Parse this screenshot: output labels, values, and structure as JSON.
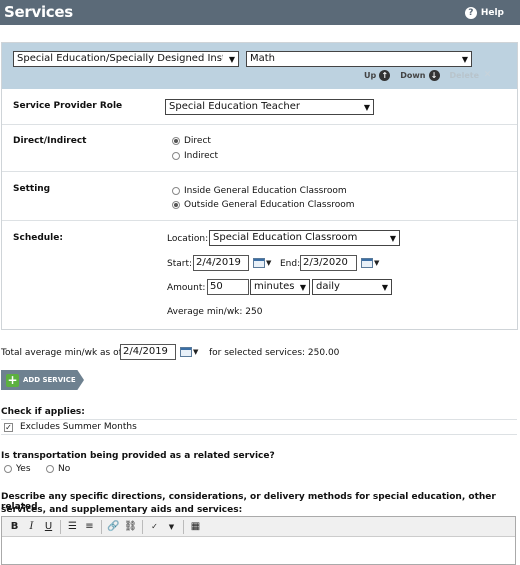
{
  "header": {
    "title": "Services",
    "help_label": "Help"
  },
  "service": {
    "category_value": "Special Education/Specially Designed Instru",
    "subject_value": "Math",
    "controls": {
      "up": "Up",
      "down": "Down",
      "delete": "Delete"
    },
    "provider_role": {
      "label": "Service Provider Role",
      "value": "Special Education Teacher"
    },
    "direct_indirect": {
      "label": "Direct/Indirect",
      "options": [
        "Direct",
        "Indirect"
      ],
      "selected": "Direct"
    },
    "setting": {
      "label": "Setting",
      "options": [
        "Inside General Education Classroom",
        "Outside General Education Classroom"
      ],
      "selected": "Outside General Education Classroom"
    },
    "schedule": {
      "label": "Schedule:",
      "location_label": "Location:",
      "location_value": "Special Education Classroom",
      "start_label": "Start:",
      "start_value": "2/4/2019",
      "end_label": "End:",
      "end_value": "2/3/2020",
      "amount_label": "Amount:",
      "amount_value": "50",
      "unit_value": "minutes",
      "frequency_value": "daily",
      "average_text": "Average min/wk: 250"
    }
  },
  "total": {
    "prefix": "Total average min/wk as of",
    "date_value": "2/4/2019",
    "suffix": "for selected services: 250.00"
  },
  "add_service_label": "ADD SERVICE",
  "applies": {
    "heading": "Check if applies:",
    "excludes_summer": "Excludes Summer Months",
    "excludes_summer_checked": true
  },
  "transportation": {
    "question": "Is transportation being provided as a related service?",
    "yes": "Yes",
    "no": "No"
  },
  "directions": {
    "label_line1": "Describe any specific directions, considerations, or delivery methods for special education, other related",
    "label_line2": "services, and supplementary aids and services:"
  },
  "icons": [
    "help-icon",
    "up-arrow-icon",
    "down-arrow-icon",
    "delete-x-icon",
    "calendar-icon",
    "add-plus-icon",
    "bold-icon",
    "italic-icon",
    "underline-icon",
    "bullet-list-icon",
    "numbered-list-icon",
    "link-icon",
    "unlink-icon",
    "spellcheck-icon",
    "insert-table-icon"
  ]
}
